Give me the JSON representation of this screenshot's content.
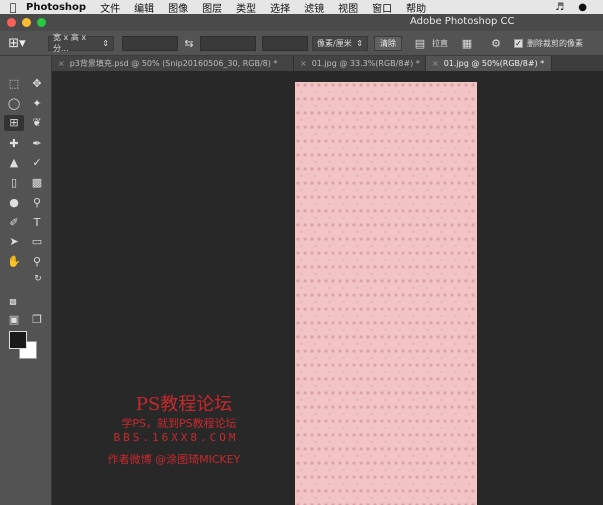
{
  "menubar": {
    "apple_icon": "apple-logo",
    "app_name": "Photoshop",
    "items": [
      "文件",
      "编辑",
      "图像",
      "图层",
      "类型",
      "选择",
      "滤镜",
      "视图",
      "窗口",
      "帮助"
    ],
    "right_icons": [
      "bell-icon",
      "qq-icon"
    ]
  },
  "window": {
    "title": "Adobe Photoshop CC",
    "traffic_lights": [
      "#fc5f57",
      "#fdbc2e",
      "#28c840"
    ]
  },
  "options_bar": {
    "ratio_dropdown": "宽 x 高 x 分...",
    "unit_dropdown": "像素/厘米",
    "clear_button": "清除",
    "straighten_label": "拉直",
    "delete_cropped_label": "删除裁剪的像素",
    "delete_cropped_checked": true
  },
  "tabs": [
    {
      "label": "p3背景填充.psd @ 50% (Snip20160506_30, RGB/8) *",
      "active": false
    },
    {
      "label": "01.jpg @ 33.3%(RGB/8#) *",
      "active": false
    },
    {
      "label": "01.jpg @ 50%(RGB/8#) *",
      "active": true
    }
  ],
  "toolbar": {
    "tools": [
      "move",
      "marquee",
      "lasso",
      "magic-wand",
      "crop",
      "eyedropper",
      "spot-healing",
      "brush",
      "clone-stamp",
      "history-brush",
      "eraser",
      "gradient",
      "blur",
      "dodge",
      "pen",
      "type",
      "path-selection",
      "rectangle",
      "hand",
      "zoom"
    ],
    "active_tool": "crop",
    "foreground_color": "#1a1a1a",
    "background_color": "#ffffff"
  },
  "canvas": {
    "document_color": "#f2c4c6",
    "pattern_color": "#d9a4a8"
  },
  "watermark": {
    "line1": "PS教程论坛",
    "line2": "学PS，就到PS教程论坛",
    "line3": "BBS.16XX8.COM",
    "line4": "作者微博 @涂图琦MICKEY"
  }
}
